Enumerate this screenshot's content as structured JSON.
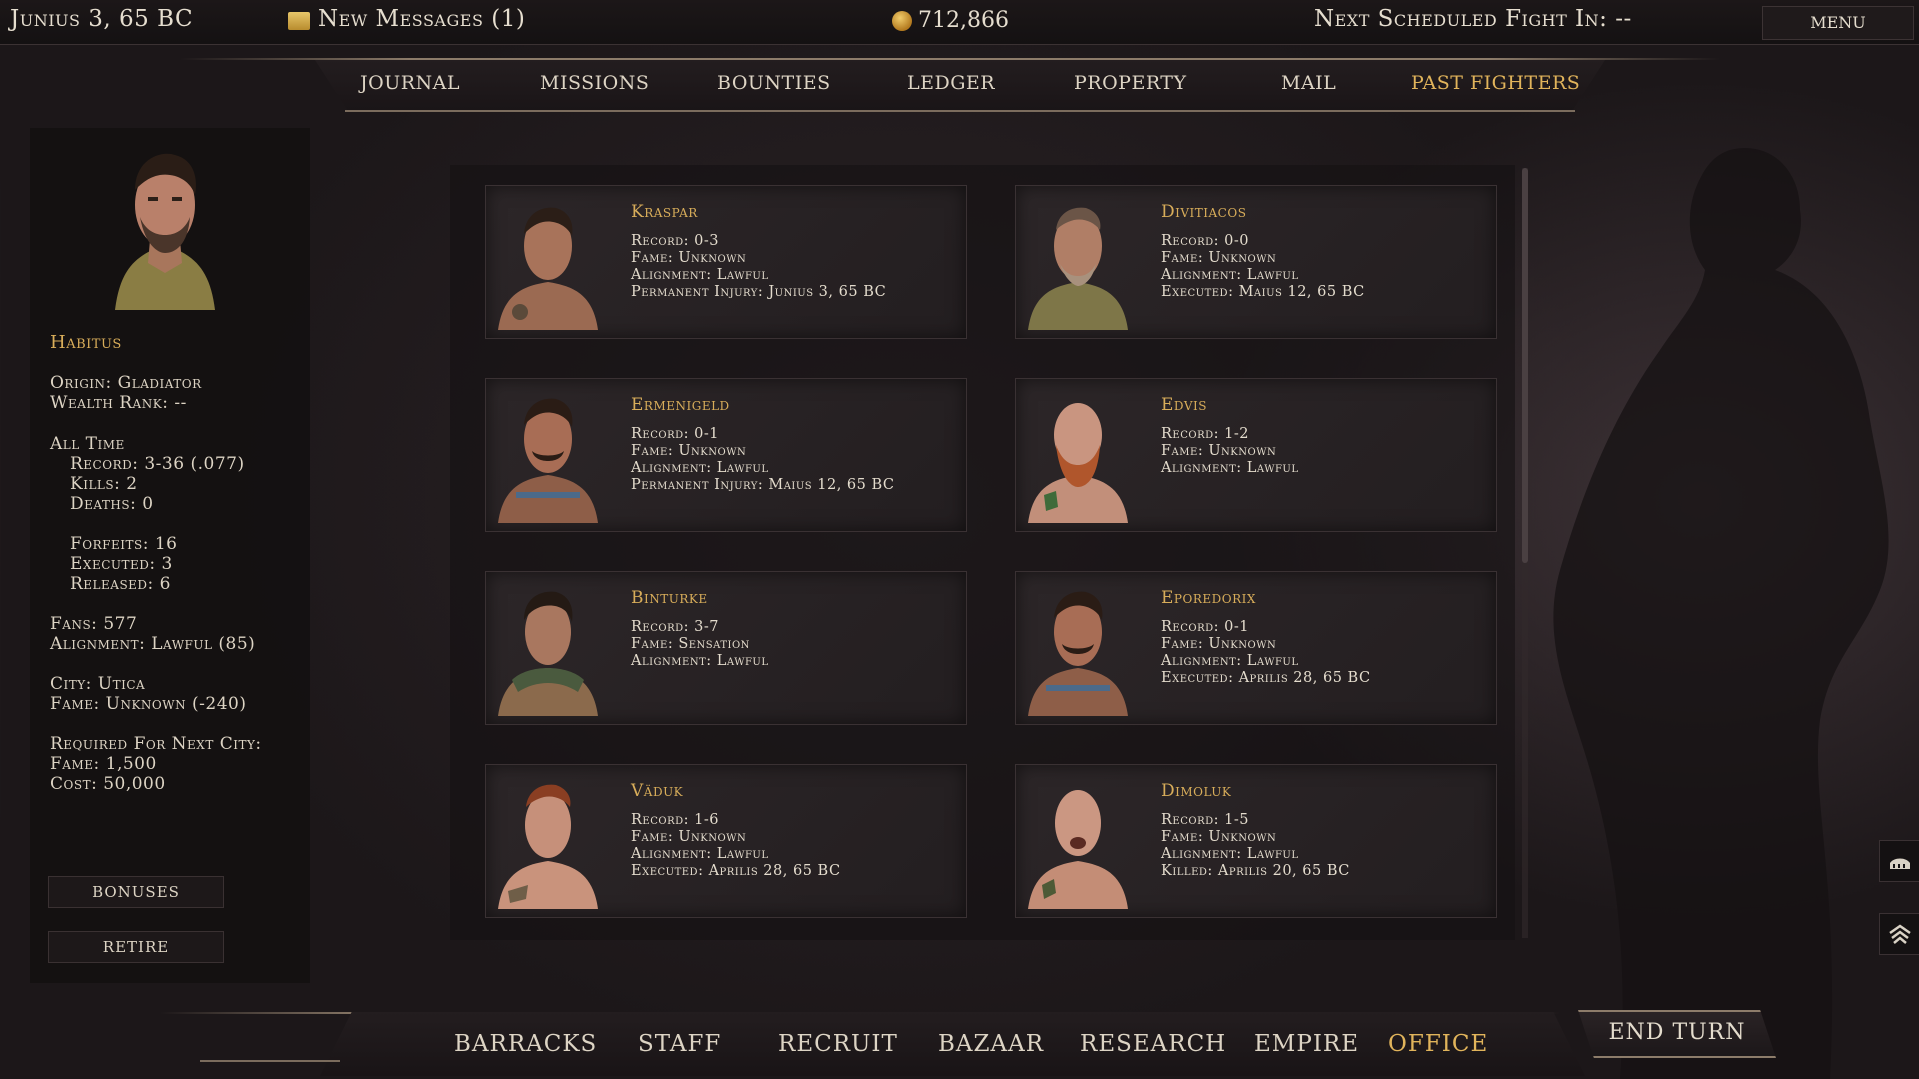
{
  "topbar": {
    "date": "Junius 3, 65 BC",
    "messages": "New Messages (1)",
    "gold": "712,866",
    "next_fight": "Next Scheduled Fight In: --",
    "menu": "MENU"
  },
  "tabs": [
    {
      "label": "JOURNAL"
    },
    {
      "label": "MISSIONS"
    },
    {
      "label": "BOUNTIES"
    },
    {
      "label": "LEDGER"
    },
    {
      "label": "PROPERTY"
    },
    {
      "label": "MAIL"
    },
    {
      "label": "PAST FIGHTERS"
    }
  ],
  "active_tab": "PAST FIGHTERS",
  "profile": {
    "name": "Habitus",
    "origin": "Origin: Gladiator",
    "wealth_rank": "Wealth Rank: --",
    "all_time": "All Time",
    "record": "Record: 3-36 (.077)",
    "kills": "Kills: 2",
    "deaths": "Deaths: 0",
    "forfeits": "Forfeits: 16",
    "executed": "Executed: 3",
    "released": "Released: 6",
    "fans": "Fans: 577",
    "alignment": "Alignment: Lawful (85)",
    "city": "City: Utica",
    "fame": "Fame: Unknown (-240)",
    "required_next_city": "Required For Next City:",
    "required_fame": "Fame: 1,500",
    "required_cost": "Cost: 50,000",
    "bonuses_button": "BONUSES",
    "retire_button": "RETIRE"
  },
  "fighters": [
    {
      "name": "Kraspar",
      "lines": [
        "Record: 0-3",
        "Fame: Unknown",
        "Alignment: Lawful",
        "Permanent Injury: Junius 3, 65 BC"
      ]
    },
    {
      "name": "Divitiacos",
      "lines": [
        "Record: 0-0",
        "Fame: Unknown",
        "Alignment: Lawful",
        "Executed: Maius 12, 65 BC"
      ]
    },
    {
      "name": "Ermenigeld",
      "lines": [
        "Record: 0-1",
        "Fame: Unknown",
        "Alignment: Lawful",
        "Permanent Injury: Maius 12, 65 BC"
      ]
    },
    {
      "name": "Edvis",
      "lines": [
        "Record: 1-2",
        "Fame: Unknown",
        "Alignment: Lawful"
      ]
    },
    {
      "name": "Binturke",
      "lines": [
        "Record: 3-7",
        "Fame: Sensation",
        "Alignment: Lawful"
      ]
    },
    {
      "name": "Eporedorix",
      "lines": [
        "Record: 0-1",
        "Fame: Unknown",
        "Alignment: Lawful",
        "Executed: Aprilis 28, 65 BC"
      ]
    },
    {
      "name": "Väduk",
      "lines": [
        "Record: 1-6",
        "Fame: Unknown",
        "Alignment: Lawful",
        "Executed: Aprilis 28, 65 BC"
      ]
    },
    {
      "name": "Dimoluk",
      "lines": [
        "Record: 1-5",
        "Fame: Unknown",
        "Alignment: Lawful",
        "Killed: Aprilis 20, 65 BC"
      ]
    }
  ],
  "bottom_nav": [
    {
      "label": "BARRACKS"
    },
    {
      "label": "STAFF"
    },
    {
      "label": "RECRUIT"
    },
    {
      "label": "BAZAAR"
    },
    {
      "label": "RESEARCH"
    },
    {
      "label": "EMPIRE"
    },
    {
      "label": "OFFICE"
    }
  ],
  "active_nav": "OFFICE",
  "end_turn": "END TURN",
  "colors": {
    "accent_gold": "#d8ad5a",
    "active_tab": "#e1b45b",
    "text": "#e4dccd",
    "background": "#1b1618"
  },
  "icons": {
    "messages": "scroll-icon",
    "gold": "coin-icon",
    "side_top": "colosseum-icon",
    "side_bottom": "rank-chevron-icon"
  }
}
